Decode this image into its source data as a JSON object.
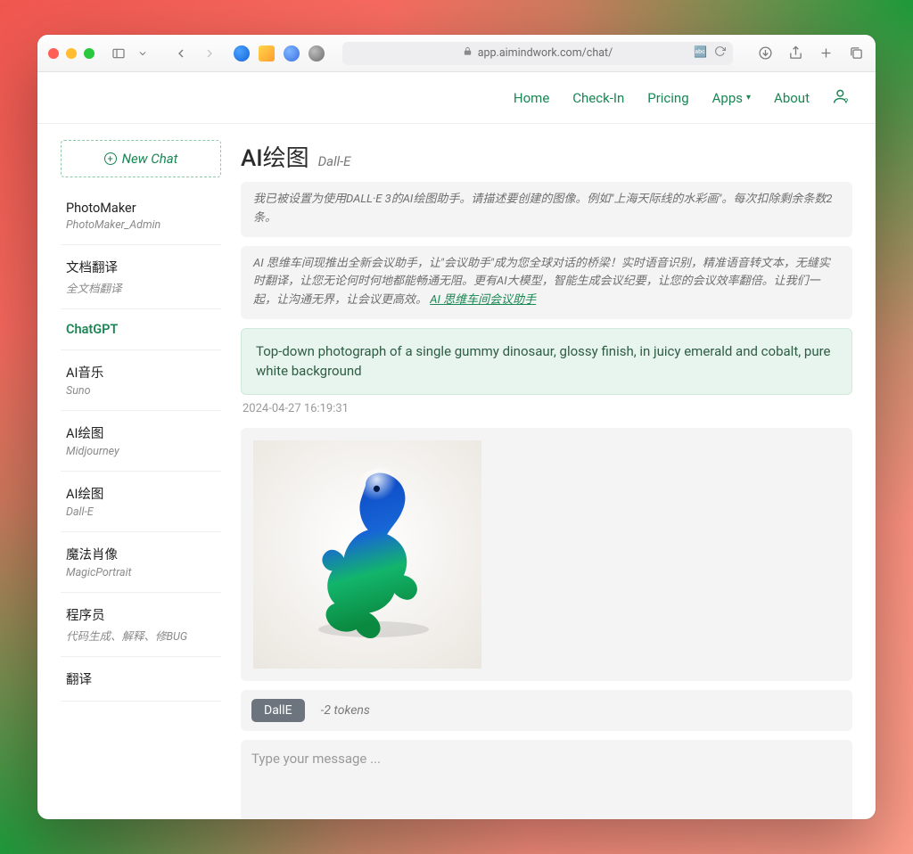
{
  "browser": {
    "url": "app.aimindwork.com/chat/"
  },
  "nav": {
    "home": "Home",
    "check_in": "Check-In",
    "pricing": "Pricing",
    "apps": "Apps",
    "about": "About"
  },
  "sidebar": {
    "new_chat": "New Chat",
    "items": [
      {
        "title": "PhotoMaker",
        "sub": "PhotoMaker_Admin"
      },
      {
        "title": "文档翻译",
        "sub": "全文档翻译"
      },
      {
        "title": "ChatGPT",
        "sub": ""
      },
      {
        "title": "AI音乐",
        "sub": "Suno"
      },
      {
        "title": "AI绘图",
        "sub": "Midjourney"
      },
      {
        "title": "AI绘图",
        "sub": "Dall-E"
      },
      {
        "title": "魔法肖像",
        "sub": "MagicPortrait"
      },
      {
        "title": "程序员",
        "sub": "代码生成、解释、修BUG"
      },
      {
        "title": "翻译",
        "sub": ""
      }
    ]
  },
  "main": {
    "title": "AI绘图",
    "subtitle": "Dall-E",
    "banner1": "我已被设置为使用DALL·E 3的AI绘图助手。请描述要创建的图像。例如\"上海天际线的水彩画\"。每次扣除剩余条数2条。",
    "banner2_text": "AI 思维车间现推出全新会议助手，让\"会议助手\"成为您全球对话的桥梁！实时语音识别，精准语音转文本，无缝实时翻译，让您无论何时何地都能畅通无阻。更有AI大模型，智能生成会议纪要，让您的会议效率翻倍。让我们一起，让沟通无界，让会议更高效。",
    "banner2_link": "AI 思维车间会议助手",
    "user_message": "Top-down photograph of a single gummy dinosaur, glossy finish, in juicy emerald and cobalt, pure white background",
    "timestamp": "2024-04-27 16:19:31",
    "model_chip": "DallE",
    "tokens": "-2 tokens",
    "placeholder": "Type your message ..."
  }
}
